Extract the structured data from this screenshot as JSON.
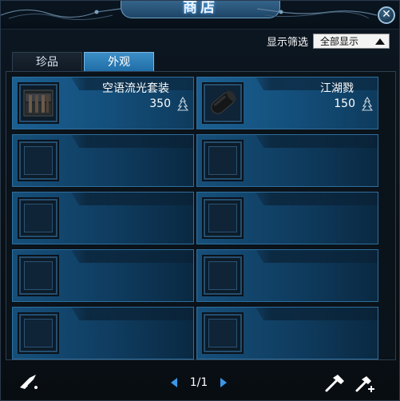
{
  "window": {
    "title": "商店",
    "close_label": "✕"
  },
  "filter": {
    "label": "显示筛选",
    "selected": "全部显示"
  },
  "tabs": [
    {
      "label": "珍品",
      "active": false
    },
    {
      "label": "外观",
      "active": true
    }
  ],
  "items": [
    {
      "name": "空语流光套装",
      "price": "350",
      "icon": "outfit-chest-icon"
    },
    {
      "name": "江湖戮",
      "price": "150",
      "icon": "dark-scroll-icon"
    }
  ],
  "empty_slots": 8,
  "pager": {
    "text": "1/1"
  },
  "colors": {
    "accent": "#3c97e8",
    "cell_blue": "#1b5f91",
    "tab_active": "#2f7fba"
  }
}
